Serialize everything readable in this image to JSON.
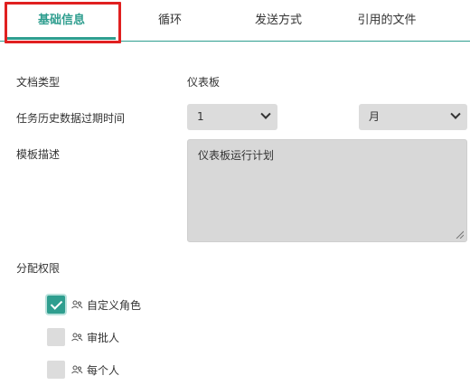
{
  "tabs": [
    {
      "label": "基础信息",
      "active": true
    },
    {
      "label": "循环",
      "active": false
    },
    {
      "label": "发送方式",
      "active": false
    },
    {
      "label": "引用的文件",
      "active": false
    }
  ],
  "form": {
    "doc_type_label": "文档类型",
    "doc_type_value": "仪表板",
    "history_expiry_label": "任务历史数据过期时间",
    "history_expiry_number": "1",
    "history_expiry_unit": "月",
    "template_desc_label": "模板描述",
    "template_desc_value": "仪表板运行计划",
    "permissions_label": "分配权限"
  },
  "permissions": [
    {
      "label": "自定义角色",
      "checked": true
    },
    {
      "label": "审批人",
      "checked": false
    },
    {
      "label": "每个人",
      "checked": false
    }
  ],
  "colors": {
    "accent": "#2f9e8f",
    "highlight": "#e02020",
    "field_bg": "#dcdcdc"
  }
}
